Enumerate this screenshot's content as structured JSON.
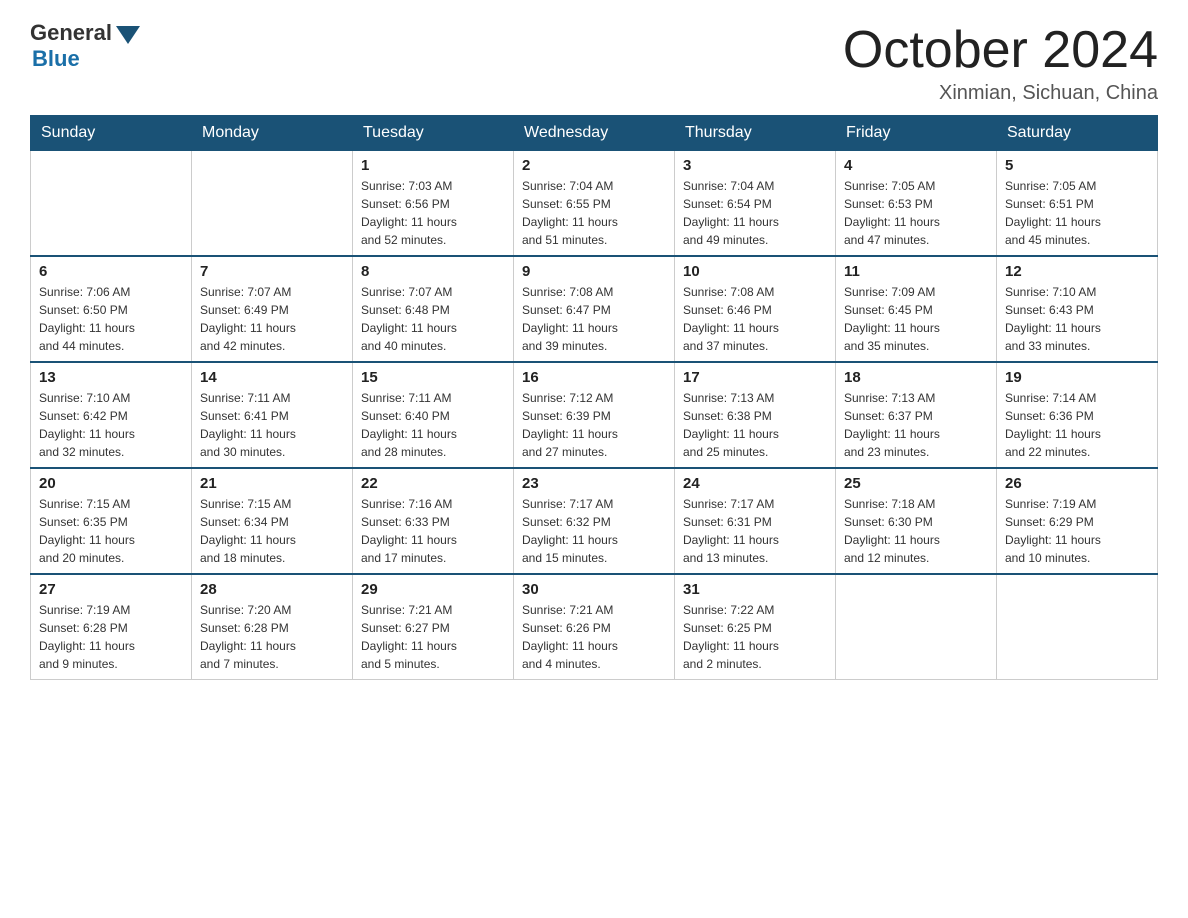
{
  "header": {
    "logo_general": "General",
    "logo_blue": "Blue",
    "month_title": "October 2024",
    "location": "Xinmian, Sichuan, China"
  },
  "days_of_week": [
    "Sunday",
    "Monday",
    "Tuesday",
    "Wednesday",
    "Thursday",
    "Friday",
    "Saturday"
  ],
  "weeks": [
    [
      {
        "day": "",
        "info": ""
      },
      {
        "day": "",
        "info": ""
      },
      {
        "day": "1",
        "info": "Sunrise: 7:03 AM\nSunset: 6:56 PM\nDaylight: 11 hours\nand 52 minutes."
      },
      {
        "day": "2",
        "info": "Sunrise: 7:04 AM\nSunset: 6:55 PM\nDaylight: 11 hours\nand 51 minutes."
      },
      {
        "day": "3",
        "info": "Sunrise: 7:04 AM\nSunset: 6:54 PM\nDaylight: 11 hours\nand 49 minutes."
      },
      {
        "day": "4",
        "info": "Sunrise: 7:05 AM\nSunset: 6:53 PM\nDaylight: 11 hours\nand 47 minutes."
      },
      {
        "day": "5",
        "info": "Sunrise: 7:05 AM\nSunset: 6:51 PM\nDaylight: 11 hours\nand 45 minutes."
      }
    ],
    [
      {
        "day": "6",
        "info": "Sunrise: 7:06 AM\nSunset: 6:50 PM\nDaylight: 11 hours\nand 44 minutes."
      },
      {
        "day": "7",
        "info": "Sunrise: 7:07 AM\nSunset: 6:49 PM\nDaylight: 11 hours\nand 42 minutes."
      },
      {
        "day": "8",
        "info": "Sunrise: 7:07 AM\nSunset: 6:48 PM\nDaylight: 11 hours\nand 40 minutes."
      },
      {
        "day": "9",
        "info": "Sunrise: 7:08 AM\nSunset: 6:47 PM\nDaylight: 11 hours\nand 39 minutes."
      },
      {
        "day": "10",
        "info": "Sunrise: 7:08 AM\nSunset: 6:46 PM\nDaylight: 11 hours\nand 37 minutes."
      },
      {
        "day": "11",
        "info": "Sunrise: 7:09 AM\nSunset: 6:45 PM\nDaylight: 11 hours\nand 35 minutes."
      },
      {
        "day": "12",
        "info": "Sunrise: 7:10 AM\nSunset: 6:43 PM\nDaylight: 11 hours\nand 33 minutes."
      }
    ],
    [
      {
        "day": "13",
        "info": "Sunrise: 7:10 AM\nSunset: 6:42 PM\nDaylight: 11 hours\nand 32 minutes."
      },
      {
        "day": "14",
        "info": "Sunrise: 7:11 AM\nSunset: 6:41 PM\nDaylight: 11 hours\nand 30 minutes."
      },
      {
        "day": "15",
        "info": "Sunrise: 7:11 AM\nSunset: 6:40 PM\nDaylight: 11 hours\nand 28 minutes."
      },
      {
        "day": "16",
        "info": "Sunrise: 7:12 AM\nSunset: 6:39 PM\nDaylight: 11 hours\nand 27 minutes."
      },
      {
        "day": "17",
        "info": "Sunrise: 7:13 AM\nSunset: 6:38 PM\nDaylight: 11 hours\nand 25 minutes."
      },
      {
        "day": "18",
        "info": "Sunrise: 7:13 AM\nSunset: 6:37 PM\nDaylight: 11 hours\nand 23 minutes."
      },
      {
        "day": "19",
        "info": "Sunrise: 7:14 AM\nSunset: 6:36 PM\nDaylight: 11 hours\nand 22 minutes."
      }
    ],
    [
      {
        "day": "20",
        "info": "Sunrise: 7:15 AM\nSunset: 6:35 PM\nDaylight: 11 hours\nand 20 minutes."
      },
      {
        "day": "21",
        "info": "Sunrise: 7:15 AM\nSunset: 6:34 PM\nDaylight: 11 hours\nand 18 minutes."
      },
      {
        "day": "22",
        "info": "Sunrise: 7:16 AM\nSunset: 6:33 PM\nDaylight: 11 hours\nand 17 minutes."
      },
      {
        "day": "23",
        "info": "Sunrise: 7:17 AM\nSunset: 6:32 PM\nDaylight: 11 hours\nand 15 minutes."
      },
      {
        "day": "24",
        "info": "Sunrise: 7:17 AM\nSunset: 6:31 PM\nDaylight: 11 hours\nand 13 minutes."
      },
      {
        "day": "25",
        "info": "Sunrise: 7:18 AM\nSunset: 6:30 PM\nDaylight: 11 hours\nand 12 minutes."
      },
      {
        "day": "26",
        "info": "Sunrise: 7:19 AM\nSunset: 6:29 PM\nDaylight: 11 hours\nand 10 minutes."
      }
    ],
    [
      {
        "day": "27",
        "info": "Sunrise: 7:19 AM\nSunset: 6:28 PM\nDaylight: 11 hours\nand 9 minutes."
      },
      {
        "day": "28",
        "info": "Sunrise: 7:20 AM\nSunset: 6:28 PM\nDaylight: 11 hours\nand 7 minutes."
      },
      {
        "day": "29",
        "info": "Sunrise: 7:21 AM\nSunset: 6:27 PM\nDaylight: 11 hours\nand 5 minutes."
      },
      {
        "day": "30",
        "info": "Sunrise: 7:21 AM\nSunset: 6:26 PM\nDaylight: 11 hours\nand 4 minutes."
      },
      {
        "day": "31",
        "info": "Sunrise: 7:22 AM\nSunset: 6:25 PM\nDaylight: 11 hours\nand 2 minutes."
      },
      {
        "day": "",
        "info": ""
      },
      {
        "day": "",
        "info": ""
      }
    ]
  ]
}
